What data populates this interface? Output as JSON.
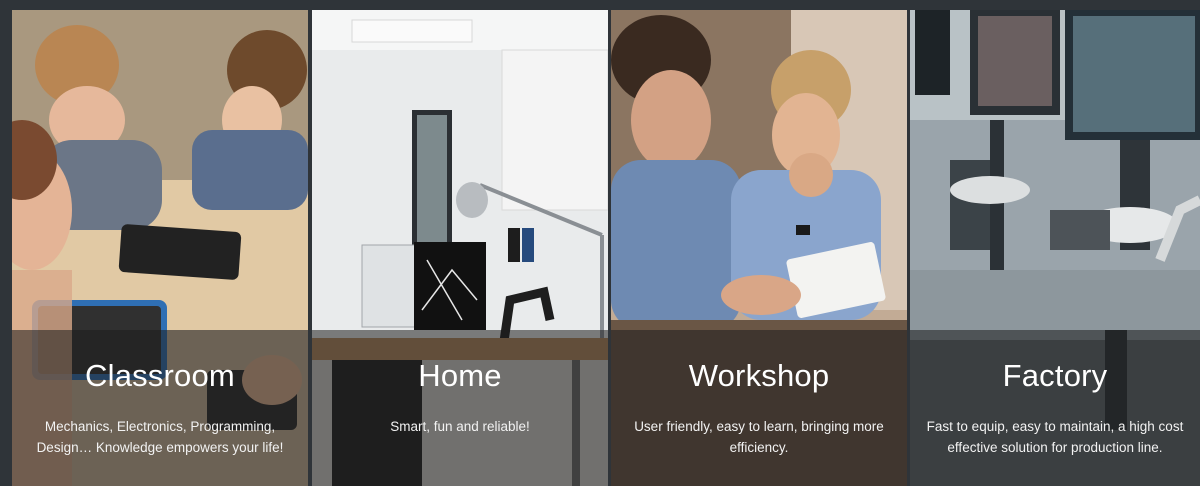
{
  "panels": [
    {
      "title": "Classroom",
      "desc_lines": [
        "Mechanics, Electronics, Programming,",
        "Design… Knowledge empowers your life!"
      ]
    },
    {
      "title": "Home",
      "desc_lines": [
        "Smart, fun and reliable!"
      ]
    },
    {
      "title": "Workshop",
      "desc_lines": [
        "User friendly, easy to learn, bringing more",
        "efficiency."
      ]
    },
    {
      "title": "Factory",
      "desc_lines": [
        "Fast to equip, easy to maintain, a high cost",
        "effective solution for production line."
      ]
    }
  ],
  "colors": {
    "frame": "#2f3439",
    "caption_overlay": "rgba(30,30,30,0.55)",
    "text": "#ffffff"
  }
}
